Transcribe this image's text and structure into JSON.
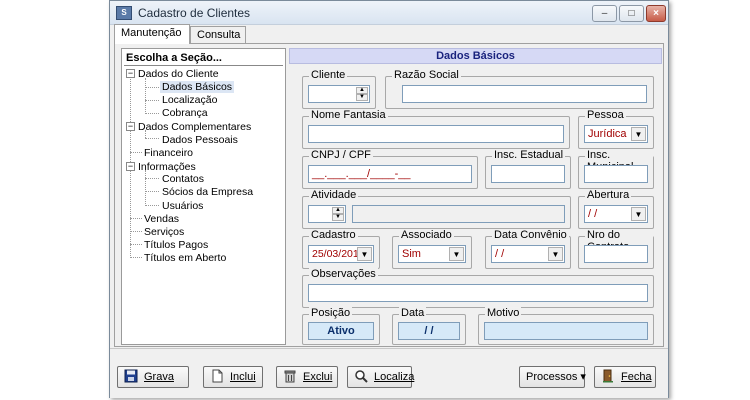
{
  "window": {
    "title": "Cadastro de Clientes",
    "minimize": "–",
    "maximize": "□",
    "close": "×"
  },
  "tabs": [
    "Manutenção",
    "Consulta"
  ],
  "tree": {
    "header": "Escolha a Seção...",
    "items": [
      "Dados do Cliente",
      "Dados Básicos",
      "Localização",
      "Cobrança",
      "Dados Complementares",
      "Dados Pessoais",
      "Financeiro",
      "Informações",
      "Contatos",
      "Sócios da Empresa",
      "Usuários",
      "Vendas",
      "Serviços",
      "Títulos Pagos",
      "Títulos em Aberto"
    ],
    "expander": "−"
  },
  "section_title": "Dados Básicos",
  "form": {
    "cliente_label": "Cliente",
    "razao_social_label": "Razão Social",
    "nome_fantasia_label": "Nome Fantasia",
    "pessoa_label": "Pessoa",
    "pessoa_value": "Jurídica",
    "cnpj_label": "CNPJ / CPF",
    "cnpj_mask": "__.___.___/____-__",
    "insc_estadual_label": "Insc. Estadual",
    "insc_municipal_label": "Insc. Municipal",
    "atividade_label": "Atividade",
    "abertura_label": "Abertura",
    "abertura_value": "/ /",
    "cadastro_label": "Cadastro",
    "cadastro_value": "25/03/2016",
    "associado_label": "Associado",
    "associado_value": "Sim",
    "data_convenio_label": "Data Convênio",
    "data_convenio_value": "/ /",
    "nro_contrato_label": "Nro do Contrato",
    "observacoes_label": "Observações",
    "posicao_label": "Posição",
    "posicao_value": "Ativo",
    "data_label": "Data",
    "data_value": "/ /",
    "motivo_label": "Motivo"
  },
  "buttons": {
    "grava": "Grava",
    "inclui": "Inclui",
    "exclui": "Exclui",
    "localiza": "Localiza",
    "processos": "Processos ▾",
    "fecha": "Fecha"
  },
  "icons": [
    "app-icon",
    "save-icon",
    "new-document-icon",
    "trash-icon",
    "search-icon",
    "door-exit-icon"
  ],
  "colors": {
    "accent_header": "#d6d9f5",
    "combo_value_text": "#a00000",
    "info_field_bg": "#d6e9f8"
  }
}
